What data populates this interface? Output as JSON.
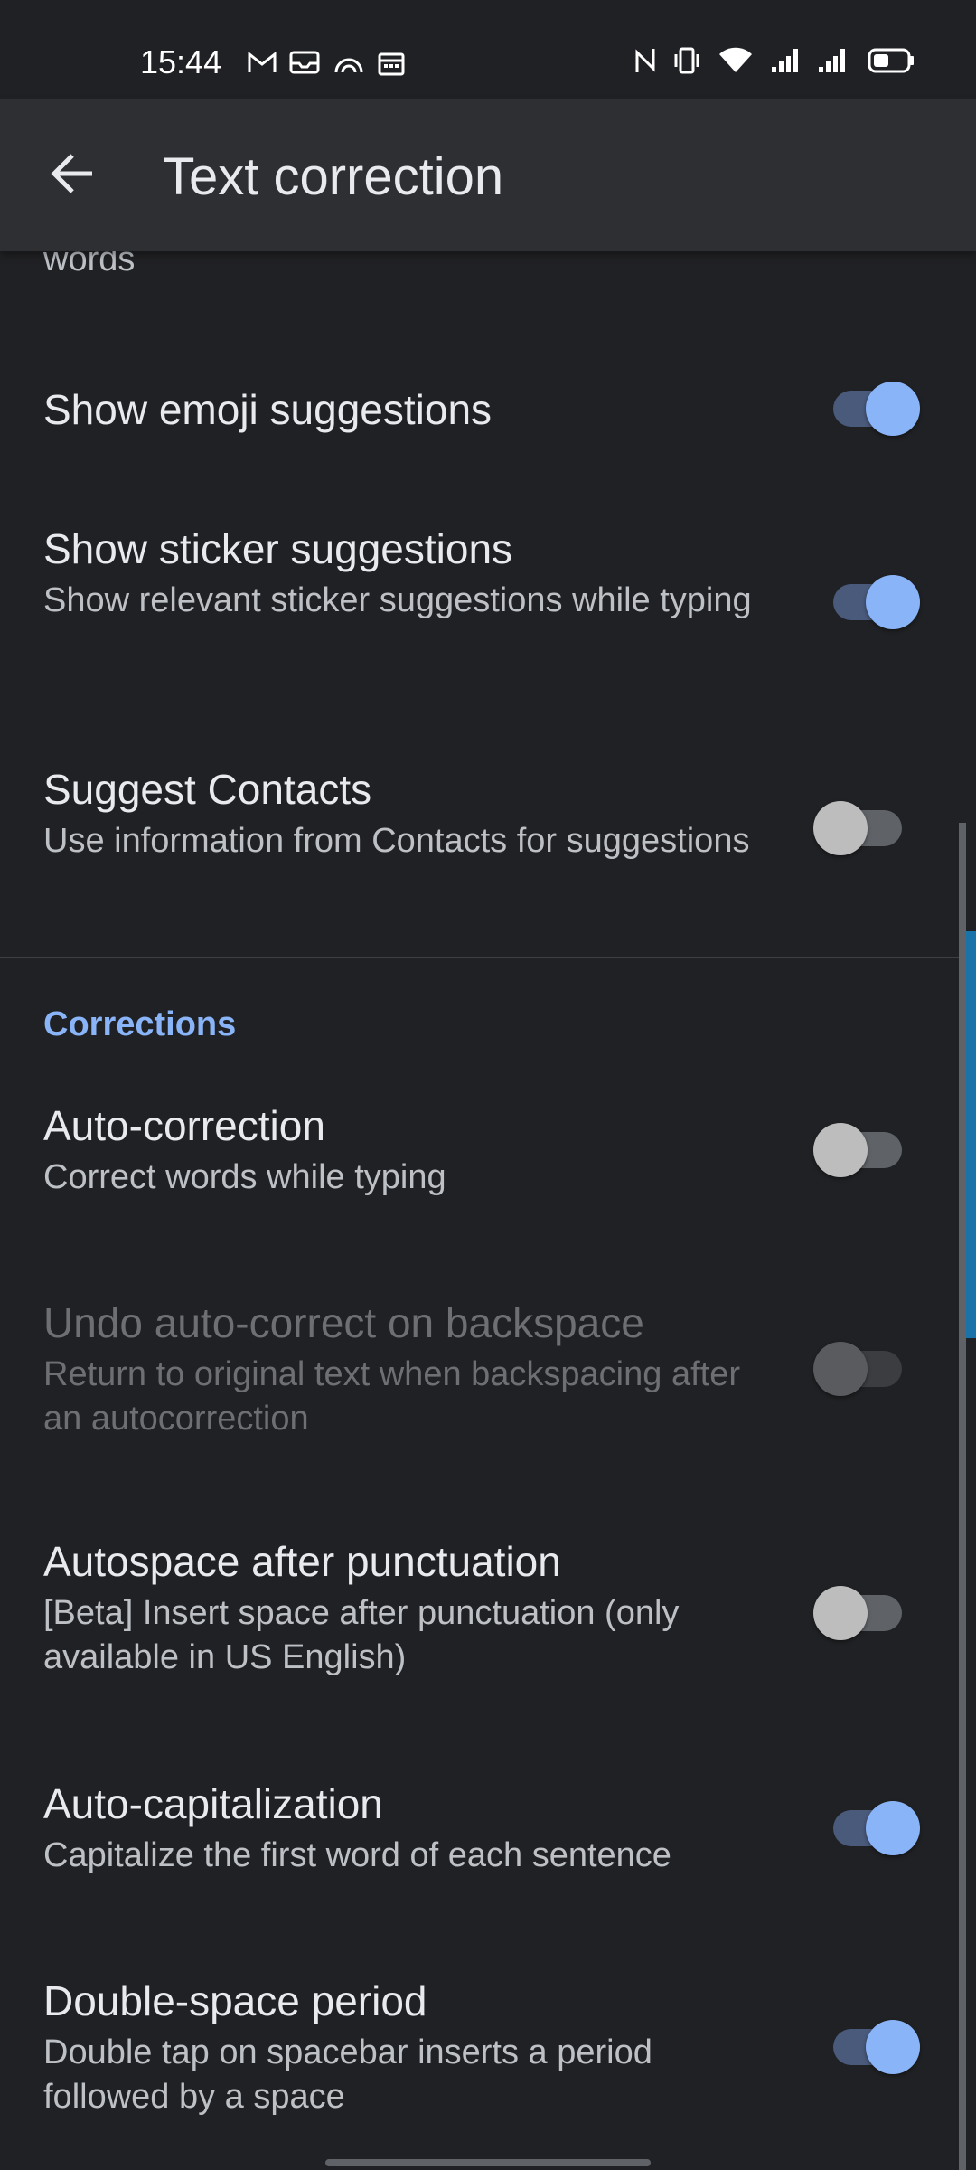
{
  "status_bar": {
    "time": "15:44",
    "left_icons": [
      "gmail-icon",
      "mail-icon",
      "hotspot-icon",
      "calendar-icon"
    ],
    "right_icons": [
      "nfc-icon",
      "vibrate-icon",
      "wifi-icon",
      "signal-icon",
      "signal-icon",
      "battery-icon"
    ]
  },
  "app_bar": {
    "title": "Text correction",
    "back_icon": "arrow-back-icon"
  },
  "content": {
    "cut_text": "words",
    "preferences_top": [
      {
        "title": "Show emoji suggestions",
        "summary": "",
        "enabled": true,
        "checked": true
      },
      {
        "title": "Show sticker suggestions",
        "summary": "Show relevant sticker suggestions while typing",
        "enabled": true,
        "checked": true
      },
      {
        "title": "Suggest Contacts",
        "summary": "Use information from Contacts for suggestions",
        "enabled": true,
        "checked": false
      }
    ],
    "category_corrections": "Corrections",
    "preferences_corrections": [
      {
        "title": "Auto-correction",
        "summary": "Correct words while typing",
        "enabled": true,
        "checked": false
      },
      {
        "title": "Undo auto-correct on backspace",
        "summary": "Return to original text when backspacing after an autocorrection",
        "enabled": false,
        "checked": false
      },
      {
        "title": "Autospace after punctuation",
        "summary": "[Beta] Insert space after punctuation (only available in US English)",
        "enabled": true,
        "checked": false
      },
      {
        "title": "Auto-capitalization",
        "summary": "Capitalize the first word of each sentence",
        "enabled": true,
        "checked": true
      },
      {
        "title": "Double-space period",
        "summary": "Double tap on spacebar inserts a period followed by a space",
        "enabled": true,
        "checked": true
      }
    ]
  },
  "colors": {
    "background": "#202124",
    "app_bar": "#2e2f32",
    "accent": "#8ab4f8",
    "text_primary": "#e8eaed",
    "text_secondary": "#bdc1c6",
    "disabled": "#6d6f73"
  }
}
